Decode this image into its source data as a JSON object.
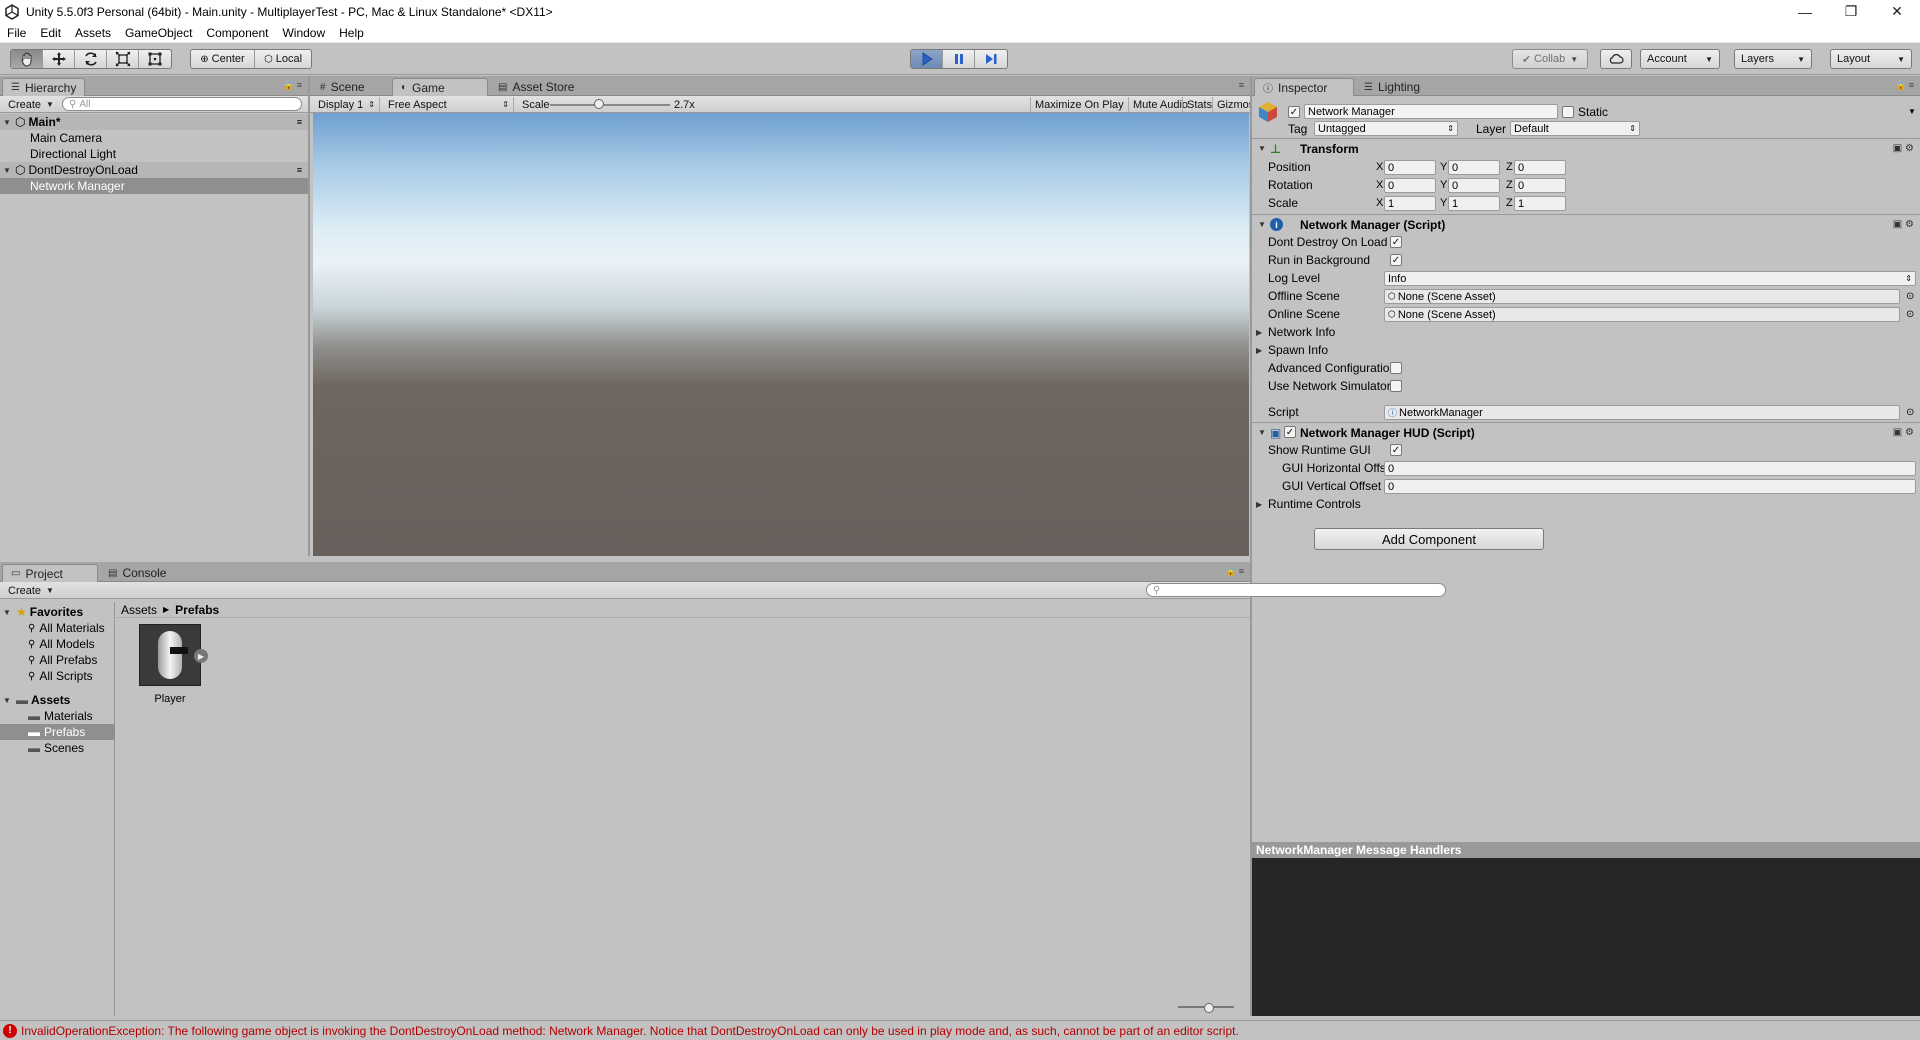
{
  "window": {
    "title": "Unity 5.5.0f3 Personal (64bit) - Main.unity - MultiplayerTest - PC, Mac & Linux Standalone* <DX11>",
    "controls": {
      "minimize": "—",
      "maximize": "❐",
      "close": "✕"
    }
  },
  "menu": [
    "File",
    "Edit",
    "Assets",
    "GameObject",
    "Component",
    "Window",
    "Help"
  ],
  "toolbar": {
    "pivot": "Center",
    "space": "Local",
    "collab": "Collab",
    "account": "Account",
    "layers": "Layers",
    "layout": "Layout",
    "play_state": "playing",
    "accent_color": "#4f79c7"
  },
  "hierarchy": {
    "tab": "Hierarchy",
    "create": "Create",
    "search_placeholder": "All",
    "scene_main": "Main*",
    "items_main": [
      "Main Camera",
      "Directional Light"
    ],
    "scene_ddol": "DontDestroyOnLoad",
    "items_ddol": [
      "Network Manager"
    ],
    "selected": "Network Manager"
  },
  "gameview": {
    "tabs": [
      "Scene",
      "Game",
      "Asset Store"
    ],
    "active_tab": "Game",
    "display": "Display 1",
    "aspect": "Free Aspect",
    "scale_label": "Scale",
    "scale_value": "2.7x",
    "scale_fraction": 0.41,
    "options": [
      "Maximize On Play",
      "Mute Audio",
      "Stats",
      "Gizmos"
    ]
  },
  "inspector": {
    "tabs": [
      "Inspector",
      "Lighting"
    ],
    "object_name": "Network Manager",
    "static_label": "Static",
    "tag_label": "Tag",
    "tag_value": "Untagged",
    "layer_label": "Layer",
    "layer_value": "Default",
    "transform": {
      "title": "Transform",
      "rows": [
        {
          "label": "Position",
          "x": "0",
          "y": "0",
          "z": "0"
        },
        {
          "label": "Rotation",
          "x": "0",
          "y": "0",
          "z": "0"
        },
        {
          "label": "Scale",
          "x": "1",
          "y": "1",
          "z": "1"
        }
      ]
    },
    "nm": {
      "title": "Network Manager (Script)",
      "dont_destroy": "Dont Destroy On Load",
      "run_bg": "Run in Background",
      "log_level": "Log Level",
      "log_level_value": "Info",
      "offline_scene": "Offline Scene",
      "offline_value": "None (Scene Asset)",
      "online_scene": "Online Scene",
      "online_value": "None (Scene Asset)",
      "network_info": "Network Info",
      "spawn_info": "Spawn Info",
      "advanced": "Advanced Configuratio",
      "simulator": "Use Network Simulator",
      "script": "Script",
      "script_value": "NetworkManager"
    },
    "hud": {
      "title": "Network Manager HUD (Script)",
      "show_gui": "Show Runtime GUI",
      "h_offset": "GUI Horizontal Offse",
      "h_value": "0",
      "v_offset": "GUI Vertical Offset",
      "v_value": "0",
      "runtime_controls": "Runtime Controls"
    },
    "add_component": "Add Component",
    "message_handlers": "NetworkManager Message Handlers"
  },
  "project": {
    "tabs": [
      "Project",
      "Console"
    ],
    "create": "Create",
    "favorites": "Favorites",
    "favorite_items": [
      "All Materials",
      "All Models",
      "All Prefabs",
      "All Scripts"
    ],
    "assets": "Assets",
    "asset_folders": [
      "Materials",
      "Prefabs",
      "Scenes"
    ],
    "selected_folder": "Prefabs",
    "breadcrumb": [
      "Assets",
      "Prefabs"
    ],
    "files": [
      "Player"
    ]
  },
  "status": {
    "message": "InvalidOperationException: The following game object is invoking the DontDestroyOnLoad method: Network Manager. Notice that DontDestroyOnLoad can only be used in play mode and, as such, cannot be part of an editor script.",
    "color": "#b20000"
  }
}
